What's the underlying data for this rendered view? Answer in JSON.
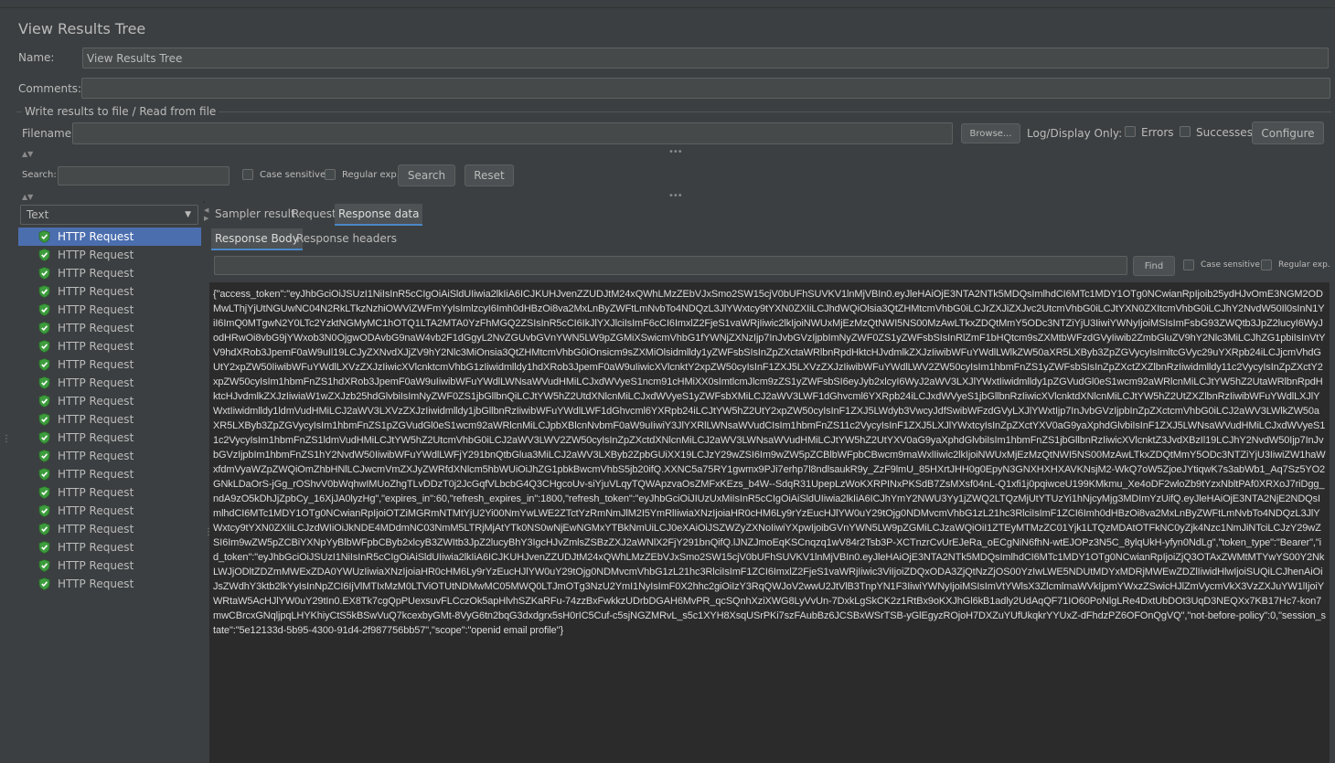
{
  "panel": {
    "title": "View Results Tree",
    "name_label": "Name:",
    "name_value": "View Results Tree",
    "comments_label": "Comments:",
    "comments_value": "",
    "write_section_label": "Write results to file / Read from file",
    "filename_label": "Filename",
    "filename_value": "",
    "browse_label": "Browse...",
    "log_display_label": "Log/Display Only:",
    "errors_label": "Errors",
    "successes_label": "Successes",
    "configure_label": "Configure"
  },
  "search": {
    "label": "Search:",
    "value": "",
    "case_sensitive_label": "Case sensitive",
    "regex_label": "Regular exp.",
    "search_button": "Search",
    "reset_button": "Reset"
  },
  "renderer": {
    "selected": "Text"
  },
  "tree": {
    "items": [
      "HTTP Request",
      "HTTP Request",
      "HTTP Request",
      "HTTP Request",
      "HTTP Request",
      "HTTP Request",
      "HTTP Request",
      "HTTP Request",
      "HTTP Request",
      "HTTP Request",
      "HTTP Request",
      "HTTP Request",
      "HTTP Request",
      "HTTP Request",
      "HTTP Request",
      "HTTP Request",
      "HTTP Request",
      "HTTP Request",
      "HTTP Request",
      "HTTP Request"
    ],
    "status_color": "#3d9c3d"
  },
  "tabs": {
    "sampler_result": "Sampler result",
    "request": "Request",
    "response_data": "Response data"
  },
  "subtabs": {
    "response_body": "Response Body",
    "response_headers": "Response headers"
  },
  "find": {
    "value": "",
    "find_button": "Find",
    "case_sensitive_label": "Case sensitive",
    "regex_label": "Regular exp."
  },
  "response": {
    "body": "{\"access_token\":\"eyJhbGciOiJSUzI1NiIsInR5cCIgOiAiSldUIiwia2lkIiA6ICJKUHJvenZZUDJtM24xQWhLMzZEbVJxSmo2SW15cjV0bUFhSUVKV1lnMjVBIn0.eyJleHAiOjE3NTA2NTk5MDQsImlhdCI6MTc1MDY1OTg0NCwianRpIjoib25ydHJvOmE3NGM2ODMwLThjYjUtNGUwNC04N2RkLTkzNzhiOWViZWFmYyIsImlzcyI6Imh0dHBzOi8va2MxLnByZWFtLmNvbTo4NDQzL3JlYWxtcy9tYXN0ZXIiLCJhdWQiOlsia3QtZHMtcmVhbG0iLCJrZXJiZXJvc2UtcmVhbG0iLCJtYXN0ZXItcmVhbG0iLCJhY2NvdW50Il0sInN1YiI6ImQ0MTgwN2Y0LTc2YzktNGMyMC1hOTQ1LTA2MTA0YzFhMGQ2ZSIsInR5cCI6IkJlYXJlciIsImF6cCI6ImxlZ2FjeS1vaWRjIiwic2lkIjoiNWUxMjEzMzQtNWI5NS00MzAwLTkxZDQtMmY5ODc3NTZiYjU3IiwiYWNyIjoiMSIsImFsbG93ZWQtb3JpZ2lucyI6WyJodHRwOi8vbG9jYWxob3N0OjgwODAvbG9naW4vb2F1dGgyL2NvZGUvbGVnYWN5LW9pZGMiXSwicmVhbG1fYWNjZXNzIjp7InJvbGVzIjpbImNyZWF0ZS1yZWFsbSIsInRlZmF1bHQtcm9sZXMtbWFzdGVyIiwib2ZmbGluZV9hY2Nlc3MiLCJhZG1pbiIsInVtYV9hdXRob3JpemF0aW9uIl19LCJyZXNvdXJjZV9hY2Nlc3MiOnsia3QtZHMtcmVhbG0iOnsicm9sZXMiOlsidmlldy1yZWFsbSIsInZpZXctaWRlbnRpdHktcHJvdmlkZXJzIiwibWFuYWdlLWlkZW50aXR5LXByb3ZpZGVycyIsImltcGVyc29uYXRpb24iLCJjcmVhdGUtY2xpZW50IiwibWFuYWdlLXVzZXJzIiwicXVlcnktcmVhbG1zIiwidmlldy1hdXRob3JpemF0aW9uIiwicXVlcnktY2xpZW50cyIsInF1ZXJ5LXVzZXJzIiwibWFuYWdlLWV2ZW50cyIsIm1hbmFnZS1yZWFsbSIsInZpZXctZXZlbnRzIiwidmlldy11c2VycyIsInZpZXctY2xpZW50cyIsIm1hbmFnZS1hdXRob3JpemF0aW9uIiwibWFuYWdlLWNsaWVudHMiLCJxdWVyeS1ncm91cHMiXX0sImtlcmJlcm9zZS1yZWFsbSI6eyJyb2xlcyI6WyJ2aWV3LXJlYWxtIiwidmlldy1pZGVudGl0eS1wcm92aWRlcnMiLCJtYW5hZ2UtaWRlbnRpdHktcHJvdmlkZXJzIiwiaW1wZXJzb25hdGlvbiIsImNyZWF0ZS1jbGllbnQiLCJtYW5hZ2UtdXNlcnMiLCJxdWVyeS1yZWFsbXMiLCJ2aWV3LWF1dGhvcml6YXRpb24iLCJxdWVyeS1jbGllbnRzIiwicXVlcnktdXNlcnMiLCJtYW5hZ2UtZXZlbnRzIiwibWFuYWdlLXJlYWxtIiwidmlldy1ldmVudHMiLCJ2aWV3LXVzZXJzIiwidmlldy1jbGllbnRzIiwibWFuYWdlLWF1dGhvcml6YXRpb24iLCJtYW5hZ2UtY2xpZW50cyIsInF1ZXJ5LWdyb3VwcyJdfSwibWFzdGVyLXJlYWxtIjp7InJvbGVzIjpbInZpZXctcmVhbG0iLCJ2aWV3LWlkZW50aXR5LXByb3ZpZGVycyIsIm1hbmFnZS1pZGVudGl0eS1wcm92aWRlcnMiLCJpbXBlcnNvbmF0aW9uIiwiY3JlYXRlLWNsaWVudCIsIm1hbmFnZS11c2VycyIsInF1ZXJ5LXJlYWxtcyIsInZpZXctYXV0aG9yaXphdGlvbiIsInF1ZXJ5LWNsaWVudHMiLCJxdWVyeS11c2VycyIsIm1hbmFnZS1ldmVudHMiLCJtYW5hZ2UtcmVhbG0iLCJ2aWV3LWV2ZW50cyIsInZpZXctdXNlcnMiLCJ2aWV3LWNsaWVudHMiLCJtYW5hZ2UtYXV0aG9yaXphdGlvbiIsIm1hbmFnZS1jbGllbnRzIiwicXVlcnktZ3JvdXBzIl19LCJhY2NvdW50Ijp7InJvbGVzIjpbIm1hbmFnZS1hY2NvdW50IiwibWFuYWdlLWFjY291bnQtbGlua3MiLCJ2aWV3LXByb2ZpbGUiXX19LCJzY29wZSI6Im9wZW5pZCBlbWFpbCBwcm9maWxlIiwic2lkIjoiNWUxMjEzMzQtNWI5NS00MzAwLTkxZDQtMmY5ODc3NTZiYjU3IiwiZW1haWxfdmVyaWZpZWQiOmZhbHNlLCJwcmVmZXJyZWRfdXNlcm5hbWUiOiJhZG1pbkBwcmVhbS5jb20ifQ.XXNC5a75RY1gwmx9PJi7erhp7l8ndlsaukR9y_ZzF9lmU_85HXrtJHH0g0EpyN3GNXHXHXAVKNsjM2-WkQ7oW5ZjoeJYtiqwK7s3abWb1_Aq7Sz5YO2GNkLDaOrS-jGg_rOShvV0bWqhwIMUoZhgTLvDDzT0j2JcGqfVLbcbG4Q3CHgcoUv-siYjuVLqyTQWApzvaOsZMFxKEzs_b4W--SdqR31UpepLzWoKXRPINxPKSdB7ZsMXsf04nL-Q1xfi1j0pqiwceU199KMkmu_Xe4oDF2wloZb9tYzxNbltPAf0XRXoJ7riDgg_ndA9zO5kDhJjZpbCy_16XjJA0lyzHg\",\"expires_in\":60,\"refresh_expires_in\":1800,\"refresh_token\":\"eyJhbGciOiJIUzUxMiIsInR5cCIgOiAiSldUIiwia2lkIiA6ICJhYmY2NWU3Yy1jZWQ2LTQzMjUtYTUzYi1hNjcyMjg3MDImYzUifQ.eyJleHAiOjE3NTA2NjE2NDQsImlhdCI6MTc1MDY1OTg0NCwianRpIjoiOTZiMGRmNTMtYjU2Yi00NmYwLWE2ZTctYzRmNmJlM2I5YmRlIiwiaXNzIjoiaHR0cHM6Ly9rYzEucHJlYW0uY29tOjg0NDMvcmVhbG1zL21hc3RlciIsImF1ZCI6Imh0dHBzOi8va2MxLnByZWFtLmNvbTo4NDQzL3JlYWxtcy9tYXN0ZXIiLCJzdWIiOiJkNDE4MDdmNC03NmM5LTRjMjAtYTk0NS0wNjEwNGMxYTBkNmUiLCJ0eXAiOiJSZWZyZXNoIiwiYXpwIjoibGVnYWN5LW9pZGMiLCJzaWQiOiI1ZTEyMTMzZC01Yjk1LTQzMDAtOTFkNC0yZjk4Nzc1NmJiNTciLCJzY29wZSI6Im9wZW5pZCBiYXNpYyBlbWFpbCByb2xlcyB3ZWItb3JpZ2lucyBhY3IgcHJvZmlsZSBzZXJ2aWNlX2FjY291bnQifQ.lJNZJmoEqKSCnqzq1wV84r2Tsb3P-XCTnzrCvUrEJeRa_oECgNiN6fhN-wtEJOPz3N5C_8ylqUkH-yfyn0NdLg\",\"token_type\":\"Bearer\",\"id_token\":\"eyJhbGciOiJSUzI1NiIsInR5cCIgOiAiSldUIiwia2lkIiA6ICJKUHJvenZZUDJtM24xQWhLMzZEbVJxSmo2SW15cjV0bUFhSUVKV1lnMjVBIn0.eyJleHAiOjE3NTA2NTk5MDQsImlhdCI6MTc1MDY1OTg0NCwianRpIjoiZjQ3OTAxZWMtMTYwYS00Y2NkLWJjODltZDZmMWExZDA0YWUzIiwiaXNzIjoiaHR0cHM6Ly9rYzEucHJlYW0uY29tOjg0NDMvcmVhbG1zL21hc3RlciIsImF1ZCI6ImxlZ2FjeS1vaWRjIiwic3ViIjoiZDQxODA3ZjQtNzZjOS00YzIwLWE5NDUtMDYxMDRjMWEwZDZlIiwidHlwIjoiSUQiLCJhenAiOiJsZWdhY3ktb2lkYyIsInNpZCI6IjVlMTIxMzM0LTViOTUtNDMwMC05MWQ0LTJmOTg3NzU2YmI1NyIsImF0X2hhc2giOiIzY3RqQWJoV2wwU2JtVlB3TnpYN1F3IiwiYWNyIjoiMSIsImVtYWlsX3ZlcmlmaWVkIjpmYWxzZSwicHJlZmVycmVkX3VzZXJuYW1lIjoiYWRtaW5AcHJlYW0uY29tIn0.EX8Tk7cgQpPUexsuvFLCczOk5apHlvhSZKaRFu-74zzBxFwkkzUDrbDGAH6MvPR_qcSQnhXziXWG8LyVvUn-7DxkLgSkCK2z1RtBx9oKXJhGl6kB1adly2UdAqQF71IO60PoNlgLRe4DxtUbDOt3UqD3NEQXx7KB17Hc7-kon7mwCBrcxGNqljpqLHYKhiyCtS5kBSwVuQ7kcexbyGMt-8VyG6tn2bqG3dxdgrx5sH0rIC5Cuf-c5sjNGZMRvL_s5c1XYH8XsqUSrPKi7szFAubBz6JCSBxWSrTSB-yGlEgyzROjoH7DXZuYUfUkqkrYYUxZ-dFhdzPZ6OFOnQgVQ\",\"not-before-policy\":0,\"session_state\":\"5e12133d-5b95-4300-91d4-2f987756bb57\",\"scope\":\"openid email profile\"}"
  }
}
